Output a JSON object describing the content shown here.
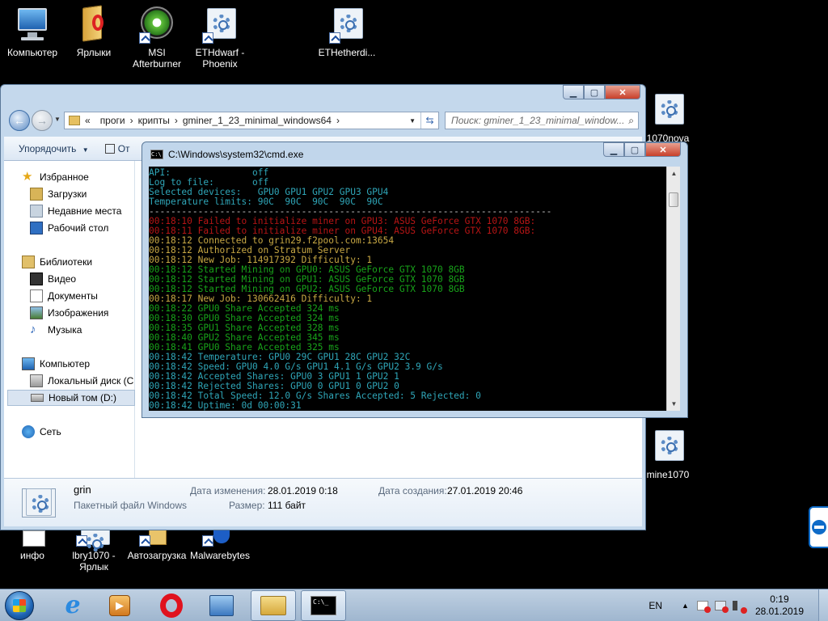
{
  "desktop": {
    "icons": [
      {
        "label": "Компьютер"
      },
      {
        "label": "Ярлыки"
      },
      {
        "label": "MSI\nAfterburner"
      },
      {
        "label": "ETHdwarf -\nPhoenix"
      },
      {
        "label": "ETHetherdi..."
      },
      {
        "label": "1070nova"
      },
      {
        "label": "mine1070"
      },
      {
        "label": "инфо"
      },
      {
        "label": "lbry1070 -\nЯрлык"
      },
      {
        "label": "Автозагрузка"
      },
      {
        "label": "Malwarebytes"
      }
    ]
  },
  "explorer": {
    "address": {
      "chevron": "«",
      "segments": [
        "проги",
        "крипты",
        "gminer_1_23_minimal_windows64"
      ],
      "separator": "›"
    },
    "search_placeholder": "Поиск: gminer_1_23_minimal_window...",
    "toolbar": {
      "organize": "Упорядочить",
      "open_partial": "От"
    },
    "nav": {
      "favorites": "Избранное",
      "downloads": "Загрузки",
      "recent": "Недавние места",
      "desktop": "Рабочий стол",
      "libraries": "Библиотеки",
      "video": "Видео",
      "documents": "Документы",
      "images": "Изображения",
      "music": "Музыка",
      "computer": "Компьютер",
      "local_disk": "Локальный диск (C",
      "new_volume": "Новый том (D:)",
      "network": "Сеть"
    },
    "details": {
      "name": "grin",
      "type": "Пакетный файл Windows",
      "modified_label": "Дата изменения:",
      "modified_value": "28.01.2019 0:18",
      "size_label": "Размер:",
      "size_value": "111 байт",
      "created_label": "Дата создания:",
      "created_value": "27.01.2019 20:46"
    }
  },
  "cmd": {
    "title": "C:\\Windows\\system32\\cmd.exe",
    "lines": [
      {
        "text": "API:               off",
        "color": "cyan"
      },
      {
        "text": "Log to file:       off",
        "color": "cyan"
      },
      {
        "text": "Selected devices:   GPU0 GPU1 GPU2 GPU3 GPU4",
        "color": "cyan"
      },
      {
        "text": "Temperature limits: 90C  90C  90C  90C  90C",
        "color": "cyan"
      },
      {
        "text": "--------------------------------------------------------------------------",
        "color": "white"
      },
      {
        "text": "00:18:10 Failed to initialize miner on GPU3: ASUS GeForce GTX 1070 8GB:",
        "color": "red"
      },
      {
        "text": "00:18:11 Failed to initialize miner on GPU4: ASUS GeForce GTX 1070 8GB:",
        "color": "red"
      },
      {
        "text": "00:18:12 Connected to grin29.f2pool.com:13654",
        "color": "gold"
      },
      {
        "text": "00:18:12 Authorized on Stratum Server",
        "color": "gold"
      },
      {
        "text": "00:18:12 New Job: 114917392 Difficulty: 1",
        "color": "gold"
      },
      {
        "text": "00:18:12 Started Mining on GPU0: ASUS GeForce GTX 1070 8GB",
        "color": "green"
      },
      {
        "text": "00:18:12 Started Mining on GPU1: ASUS GeForce GTX 1070 8GB",
        "color": "green"
      },
      {
        "text": "00:18:12 Started Mining on GPU2: ASUS GeForce GTX 1070 8GB",
        "color": "green"
      },
      {
        "text": "00:18:17 New Job: 130662416 Difficulty: 1",
        "color": "gold"
      },
      {
        "text": "00:18:22 GPU0 Share Accepted 324 ms",
        "color": "green"
      },
      {
        "text": "00:18:30 GPU0 Share Accepted 324 ms",
        "color": "green"
      },
      {
        "text": "00:18:35 GPU1 Share Accepted 328 ms",
        "color": "green"
      },
      {
        "text": "00:18:40 GPU2 Share Accepted 345 ms",
        "color": "green"
      },
      {
        "text": "00:18:41 GPU0 Share Accepted 325 ms",
        "color": "green"
      },
      {
        "text": "00:18:42 Temperature: GPU0 29C GPU1 28C GPU2 32C",
        "color": "cyan"
      },
      {
        "text": "00:18:42 Speed: GPU0 4.0 G/s GPU1 4.1 G/s GPU2 3.9 G/s",
        "color": "cyan"
      },
      {
        "text": "00:18:42 Accepted Shares: GPU0 3 GPU1 1 GPU2 1",
        "color": "cyan"
      },
      {
        "text": "00:18:42 Rejected Shares: GPU0 0 GPU1 0 GPU2 0",
        "color": "cyan"
      },
      {
        "text": "00:18:42 Total Speed: 12.0 G/s Shares Accepted: 5 Rejected: 0",
        "color": "cyan"
      },
      {
        "text": "00:18:42 Uptime: 0d 00:00:31",
        "color": "cyan"
      }
    ]
  },
  "taskbar": {
    "lang": "EN",
    "time": "0:19",
    "date": "28.01.2019"
  },
  "colors": {
    "console_cyan": "#2fa6b8",
    "console_red": "#b71515",
    "console_gold": "#c8a844",
    "console_green": "#18a31a"
  }
}
